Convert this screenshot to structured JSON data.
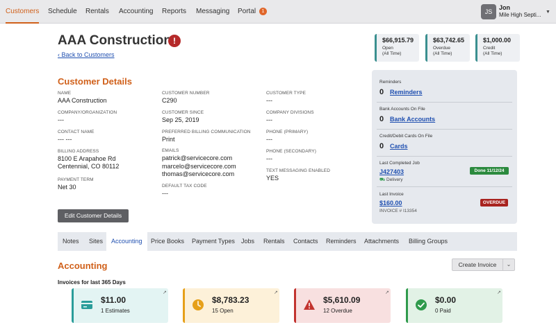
{
  "nav": {
    "items": [
      "Customers",
      "Schedule",
      "Rentals",
      "Accounting",
      "Reports",
      "Messaging",
      "Portal"
    ],
    "portal_badge": "1",
    "user": {
      "initials": "JS",
      "name": "Jon",
      "company": "Mile High Septi..."
    }
  },
  "header": {
    "title": "AAA Construction",
    "alert_glyph": "!",
    "back_link": "Back to Customers"
  },
  "summary": [
    {
      "amount": "$66,915.79",
      "label": "Open",
      "sub": "(All Time)"
    },
    {
      "amount": "$63,742.65",
      "label": "Overdue",
      "sub": "(All Time)"
    },
    {
      "amount": "$1,000.00",
      "label": "Credit",
      "sub": "(All Time)"
    }
  ],
  "details": {
    "title": "Customer Details",
    "name": {
      "label": "Name",
      "value": "AAA Construction"
    },
    "company": {
      "label": "Company/Organization",
      "value": "---"
    },
    "contact": {
      "label": "Contact Name",
      "value": "--- ---"
    },
    "billing": {
      "label": "Billing Address",
      "line1": "8100 E Arapahoe Rd",
      "line2": "Centennial, CO 80112"
    },
    "payment_term": {
      "label": "Payment Term",
      "value": "Net 30"
    },
    "customer_number": {
      "label": "Customer Number",
      "value": "C290"
    },
    "customer_since": {
      "label": "Customer Since",
      "value": "Sep 25, 2019"
    },
    "preferred_comm": {
      "label": "Preferred Billing Communication",
      "value": "Print"
    },
    "emails": {
      "label": "Emails",
      "values": [
        "patrick@servicecore.com",
        "marcelo@servicecore.com",
        "thomas@servicecore.com"
      ]
    },
    "default_tax": {
      "label": "Default Tax Code",
      "value": "---"
    },
    "customer_type": {
      "label": "Customer Type",
      "value": "---"
    },
    "divisions": {
      "label": "Company Divisions",
      "value": "---"
    },
    "phone_primary": {
      "label": "Phone (Primary)",
      "value": "---"
    },
    "phone_secondary": {
      "label": "Phone (Secondary)",
      "value": "---"
    },
    "texting": {
      "label": "Text Messaging Enabled",
      "value": "YES"
    },
    "edit_button": "Edit Customer Details"
  },
  "side": {
    "reminders": {
      "label": "Reminders",
      "count": "0",
      "link": "Reminders"
    },
    "bank": {
      "label": "Bank Accounts On File",
      "count": "0",
      "link": "Bank Accounts"
    },
    "cards": {
      "label": "Credit/Debit Cards On File",
      "count": "0",
      "link": "Cards"
    },
    "last_job": {
      "label": "Last Completed Job",
      "link": "J427403",
      "badge": "Done 11/12/24",
      "type": "Delivery"
    },
    "last_invoice": {
      "label": "Last Invoice",
      "link": "$160.00",
      "badge": "OVERDUE",
      "number": "INVOICE # I13354"
    }
  },
  "tabs": [
    "Notes",
    "Sites",
    "Accounting",
    "Price Books",
    "Payment Types",
    "Jobs",
    "Rentals",
    "Contacts",
    "Reminders",
    "Attachments",
    "Billing Groups"
  ],
  "accounting": {
    "title": "Accounting",
    "create_button": "Create Invoice",
    "period_label": "Invoices for last 365 Days",
    "cards": [
      {
        "amount": "$11.00",
        "sub": "1 Estimates",
        "color": "#2a9d9a",
        "bg": "#e3f4f3"
      },
      {
        "amount": "$8,783.23",
        "sub": "15 Open",
        "color": "#e6a019",
        "bg": "#fdf1d9"
      },
      {
        "amount": "$5,610.09",
        "sub": "12 Overdue",
        "color": "#c2332f",
        "bg": "#f8e0e0"
      },
      {
        "amount": "$0.00",
        "sub": "0 Paid",
        "color": "#2f9a4c",
        "bg": "#e2f2e6"
      }
    ]
  }
}
